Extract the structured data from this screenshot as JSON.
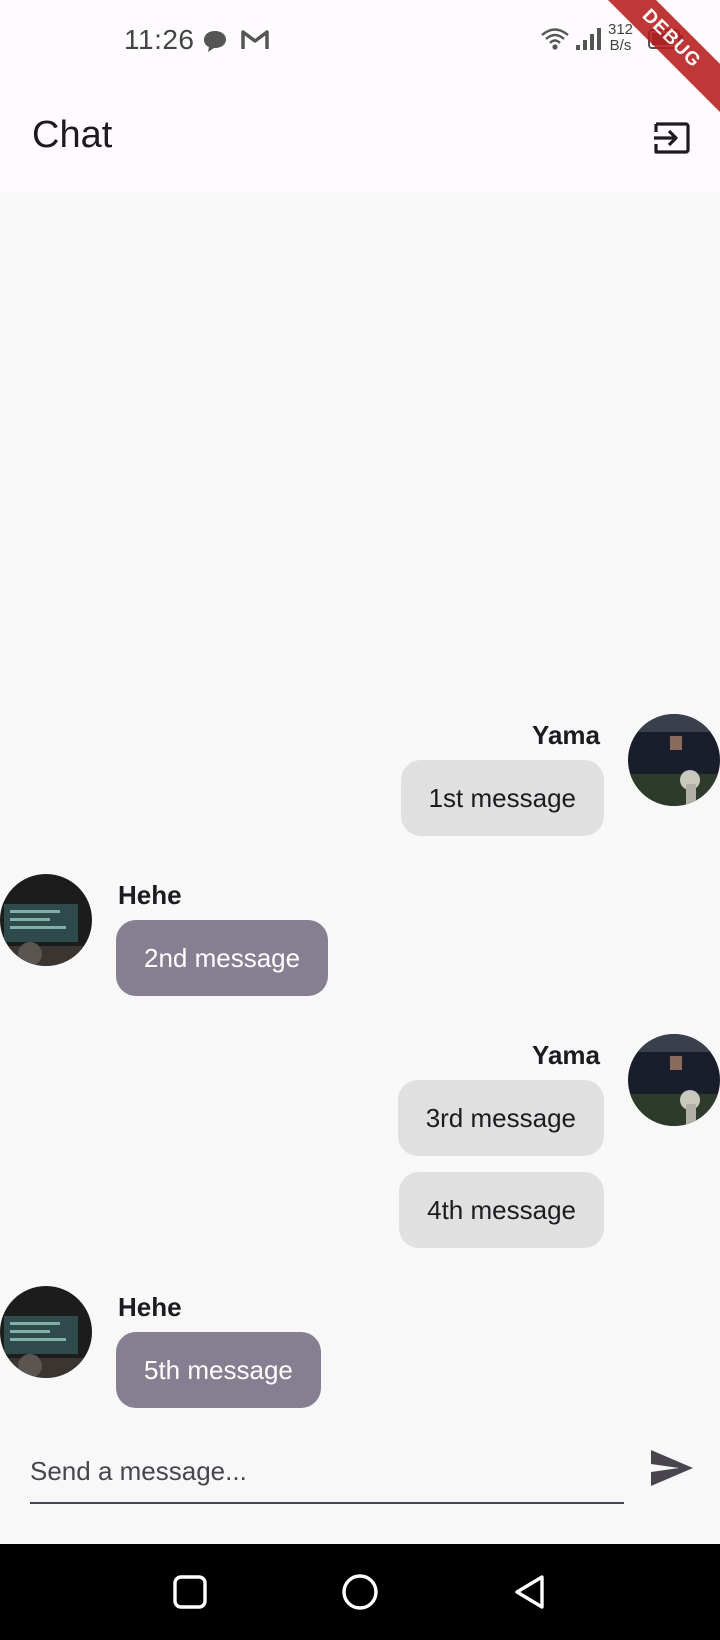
{
  "status_bar": {
    "time": "11:26",
    "speed_value": "312",
    "speed_unit": "B/s",
    "icons": [
      "chat-bubble-icon",
      "gmail-icon",
      "wifi-icon",
      "signal-icon",
      "battery-icon"
    ]
  },
  "debug_banner": "DEBUG",
  "app_bar": {
    "title": "Chat",
    "action_icon": "logout-icon"
  },
  "messages": [
    {
      "sender": "Yama",
      "side": "right",
      "bubbles": [
        "1st message"
      ]
    },
    {
      "sender": "Hehe",
      "side": "left",
      "bubbles": [
        "2nd message"
      ]
    },
    {
      "sender": "Yama",
      "side": "right",
      "bubbles": [
        "3rd message",
        "4th message"
      ]
    },
    {
      "sender": "Hehe",
      "side": "left",
      "bubbles": [
        "5th message"
      ]
    }
  ],
  "composer": {
    "placeholder": "Send a message...",
    "value": "",
    "send_icon": "send-icon"
  },
  "nav_bar": {
    "icons": [
      "recents-square-icon",
      "home-circle-icon",
      "back-triangle-icon"
    ]
  },
  "colors": {
    "my_bubble": "#e0e0e0",
    "their_bubble": "#857f91",
    "app_bar_bg": "#fefbfe",
    "chat_bg": "#f8f8f8",
    "debug_banner": "#b71c1c"
  }
}
